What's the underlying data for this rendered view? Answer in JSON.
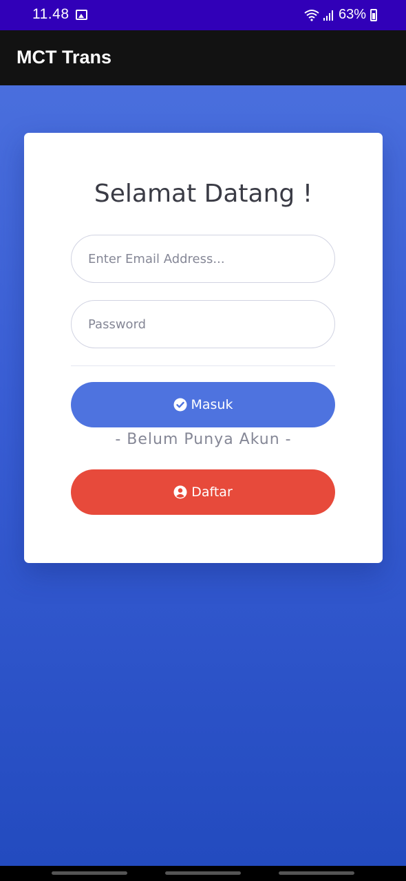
{
  "status_bar": {
    "time": "11.48",
    "battery": "63%",
    "icons": [
      "image-icon",
      "wifi-icon",
      "signal-icon",
      "battery-icon"
    ]
  },
  "app_bar": {
    "title": "MCT Trans"
  },
  "login": {
    "heading": "Selamat Datang !",
    "email_placeholder": "Enter Email Address...",
    "email_value": "",
    "password_placeholder": "Password",
    "password_value": "",
    "masuk_label": "Masuk",
    "register_hint": "- Belum Punya Akun -",
    "daftar_label": "Daftar"
  },
  "colors": {
    "status_bar": "#3100b8",
    "app_bar": "#121212",
    "background_top": "#4e73df",
    "background_bottom": "#224abe",
    "primary": "#4e73df",
    "danger": "#e74a3b"
  }
}
